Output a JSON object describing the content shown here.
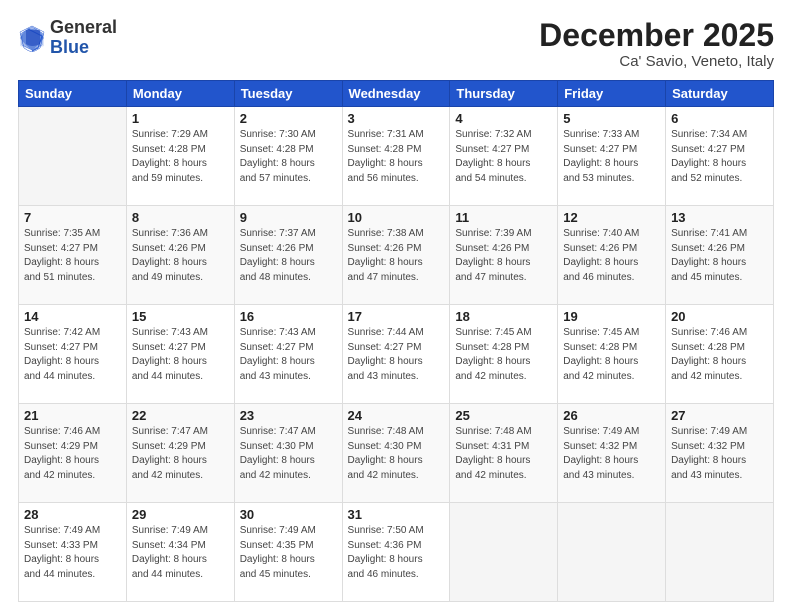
{
  "logo": {
    "general": "General",
    "blue": "Blue"
  },
  "header": {
    "title": "December 2025",
    "subtitle": "Ca' Savio, Veneto, Italy"
  },
  "weekdays": [
    "Sunday",
    "Monday",
    "Tuesday",
    "Wednesday",
    "Thursday",
    "Friday",
    "Saturday"
  ],
  "weeks": [
    [
      {
        "day": "",
        "info": ""
      },
      {
        "day": "1",
        "info": "Sunrise: 7:29 AM\nSunset: 4:28 PM\nDaylight: 8 hours\nand 59 minutes."
      },
      {
        "day": "2",
        "info": "Sunrise: 7:30 AM\nSunset: 4:28 PM\nDaylight: 8 hours\nand 57 minutes."
      },
      {
        "day": "3",
        "info": "Sunrise: 7:31 AM\nSunset: 4:28 PM\nDaylight: 8 hours\nand 56 minutes."
      },
      {
        "day": "4",
        "info": "Sunrise: 7:32 AM\nSunset: 4:27 PM\nDaylight: 8 hours\nand 54 minutes."
      },
      {
        "day": "5",
        "info": "Sunrise: 7:33 AM\nSunset: 4:27 PM\nDaylight: 8 hours\nand 53 minutes."
      },
      {
        "day": "6",
        "info": "Sunrise: 7:34 AM\nSunset: 4:27 PM\nDaylight: 8 hours\nand 52 minutes."
      }
    ],
    [
      {
        "day": "7",
        "info": "Sunrise: 7:35 AM\nSunset: 4:27 PM\nDaylight: 8 hours\nand 51 minutes."
      },
      {
        "day": "8",
        "info": "Sunrise: 7:36 AM\nSunset: 4:26 PM\nDaylight: 8 hours\nand 49 minutes."
      },
      {
        "day": "9",
        "info": "Sunrise: 7:37 AM\nSunset: 4:26 PM\nDaylight: 8 hours\nand 48 minutes."
      },
      {
        "day": "10",
        "info": "Sunrise: 7:38 AM\nSunset: 4:26 PM\nDaylight: 8 hours\nand 47 minutes."
      },
      {
        "day": "11",
        "info": "Sunrise: 7:39 AM\nSunset: 4:26 PM\nDaylight: 8 hours\nand 47 minutes."
      },
      {
        "day": "12",
        "info": "Sunrise: 7:40 AM\nSunset: 4:26 PM\nDaylight: 8 hours\nand 46 minutes."
      },
      {
        "day": "13",
        "info": "Sunrise: 7:41 AM\nSunset: 4:26 PM\nDaylight: 8 hours\nand 45 minutes."
      }
    ],
    [
      {
        "day": "14",
        "info": "Sunrise: 7:42 AM\nSunset: 4:27 PM\nDaylight: 8 hours\nand 44 minutes."
      },
      {
        "day": "15",
        "info": "Sunrise: 7:43 AM\nSunset: 4:27 PM\nDaylight: 8 hours\nand 44 minutes."
      },
      {
        "day": "16",
        "info": "Sunrise: 7:43 AM\nSunset: 4:27 PM\nDaylight: 8 hours\nand 43 minutes."
      },
      {
        "day": "17",
        "info": "Sunrise: 7:44 AM\nSunset: 4:27 PM\nDaylight: 8 hours\nand 43 minutes."
      },
      {
        "day": "18",
        "info": "Sunrise: 7:45 AM\nSunset: 4:28 PM\nDaylight: 8 hours\nand 42 minutes."
      },
      {
        "day": "19",
        "info": "Sunrise: 7:45 AM\nSunset: 4:28 PM\nDaylight: 8 hours\nand 42 minutes."
      },
      {
        "day": "20",
        "info": "Sunrise: 7:46 AM\nSunset: 4:28 PM\nDaylight: 8 hours\nand 42 minutes."
      }
    ],
    [
      {
        "day": "21",
        "info": "Sunrise: 7:46 AM\nSunset: 4:29 PM\nDaylight: 8 hours\nand 42 minutes."
      },
      {
        "day": "22",
        "info": "Sunrise: 7:47 AM\nSunset: 4:29 PM\nDaylight: 8 hours\nand 42 minutes."
      },
      {
        "day": "23",
        "info": "Sunrise: 7:47 AM\nSunset: 4:30 PM\nDaylight: 8 hours\nand 42 minutes."
      },
      {
        "day": "24",
        "info": "Sunrise: 7:48 AM\nSunset: 4:30 PM\nDaylight: 8 hours\nand 42 minutes."
      },
      {
        "day": "25",
        "info": "Sunrise: 7:48 AM\nSunset: 4:31 PM\nDaylight: 8 hours\nand 42 minutes."
      },
      {
        "day": "26",
        "info": "Sunrise: 7:49 AM\nSunset: 4:32 PM\nDaylight: 8 hours\nand 43 minutes."
      },
      {
        "day": "27",
        "info": "Sunrise: 7:49 AM\nSunset: 4:32 PM\nDaylight: 8 hours\nand 43 minutes."
      }
    ],
    [
      {
        "day": "28",
        "info": "Sunrise: 7:49 AM\nSunset: 4:33 PM\nDaylight: 8 hours\nand 44 minutes."
      },
      {
        "day": "29",
        "info": "Sunrise: 7:49 AM\nSunset: 4:34 PM\nDaylight: 8 hours\nand 44 minutes."
      },
      {
        "day": "30",
        "info": "Sunrise: 7:49 AM\nSunset: 4:35 PM\nDaylight: 8 hours\nand 45 minutes."
      },
      {
        "day": "31",
        "info": "Sunrise: 7:50 AM\nSunset: 4:36 PM\nDaylight: 8 hours\nand 46 minutes."
      },
      {
        "day": "",
        "info": ""
      },
      {
        "day": "",
        "info": ""
      },
      {
        "day": "",
        "info": ""
      }
    ]
  ]
}
